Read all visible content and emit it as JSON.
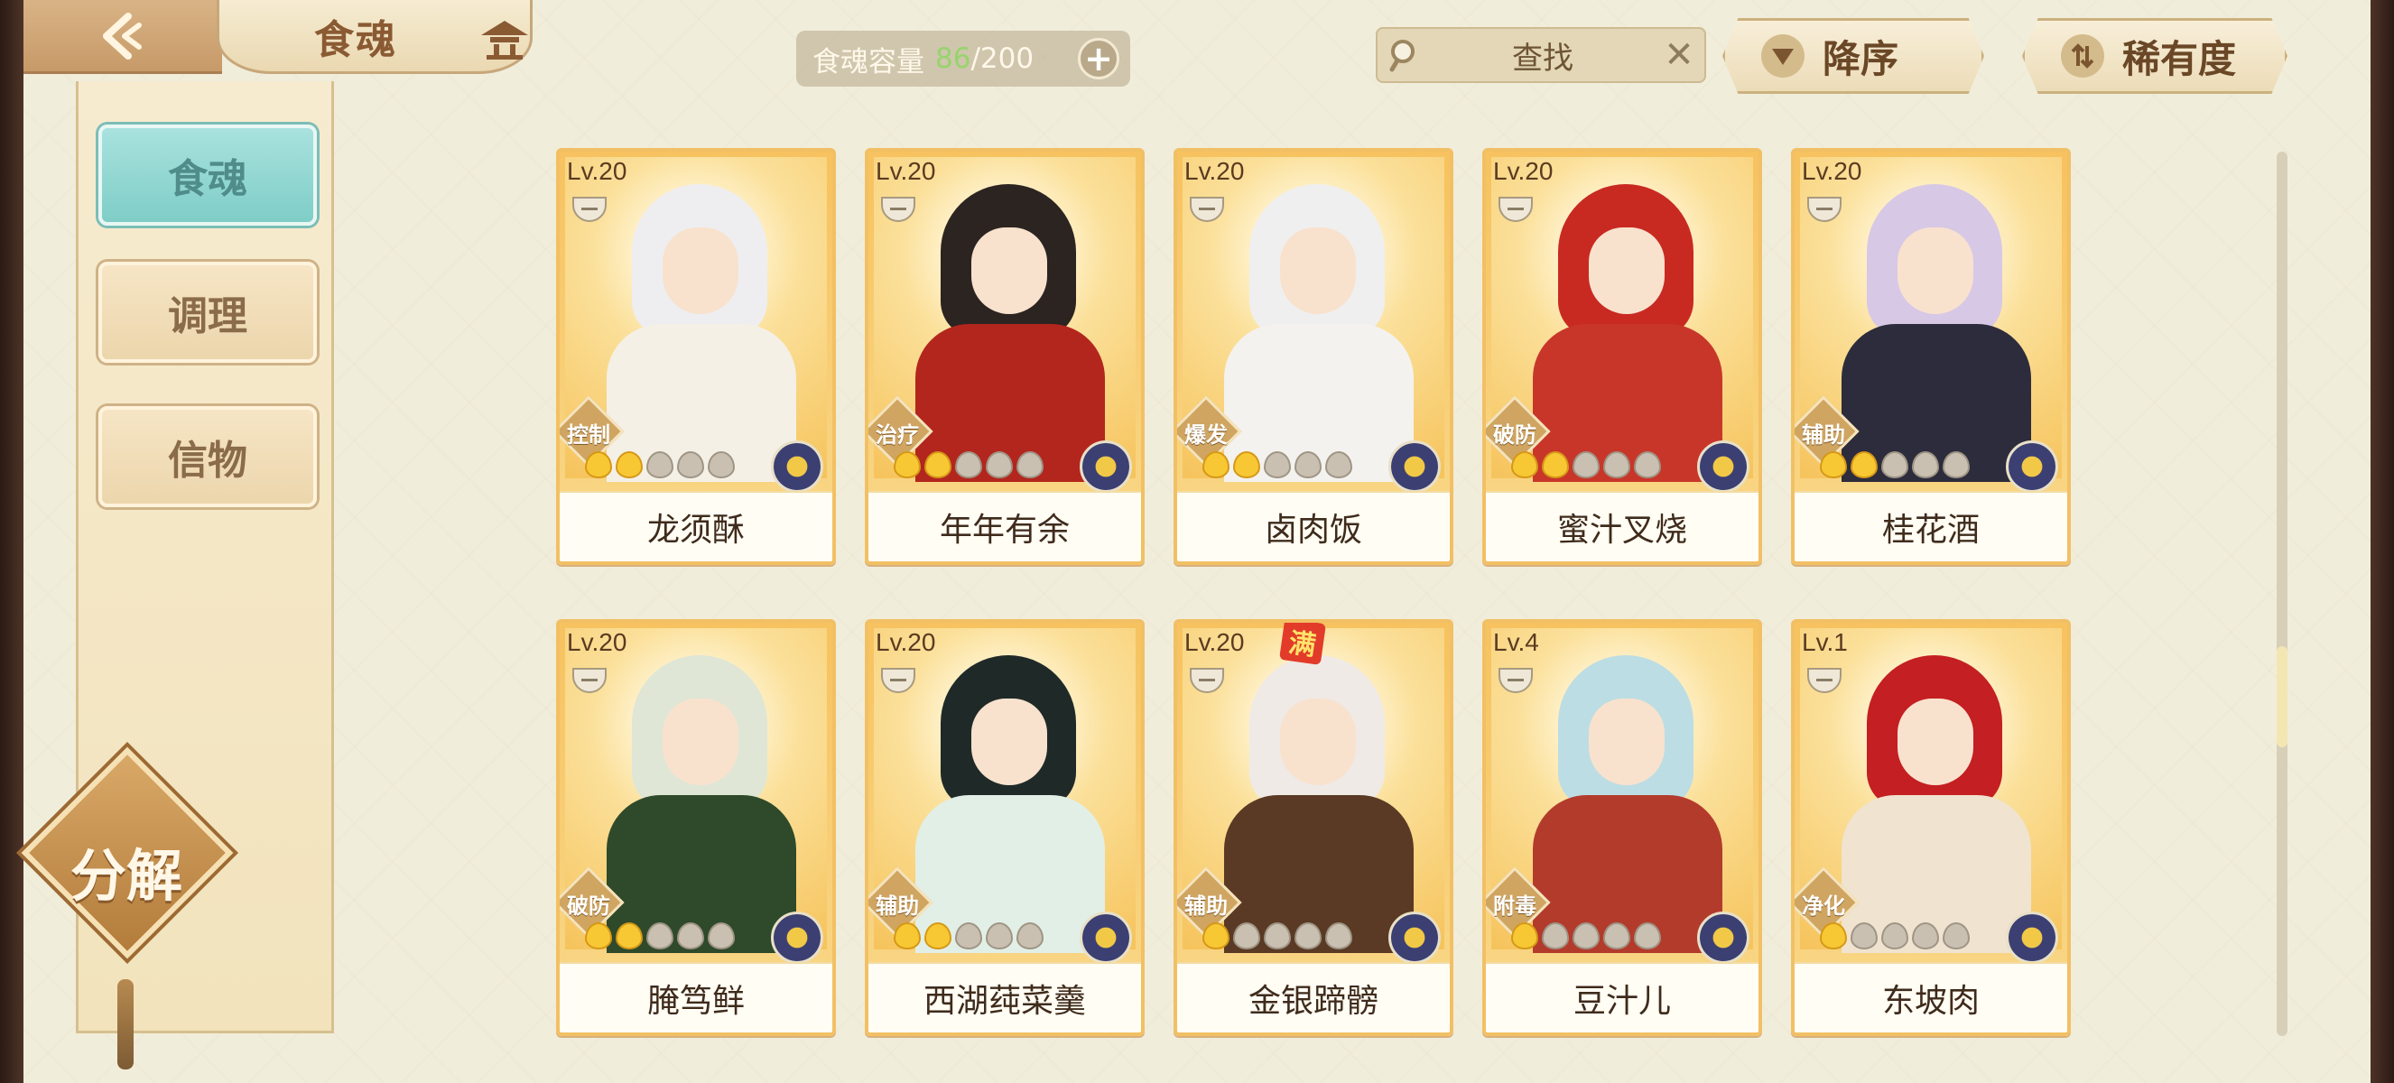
{
  "header": {
    "title": "食魂",
    "capacity_label": "食魂容量",
    "capacity_current": "86",
    "capacity_max": "200",
    "capacity_sep": "/",
    "plus_label": "+",
    "search_label": "查找",
    "close_label": "✕",
    "sort_order_label": "降序",
    "sort_field_label": "稀有度"
  },
  "sidebar": {
    "items": [
      {
        "label": "食魂",
        "active": true
      },
      {
        "label": "调理",
        "active": false
      },
      {
        "label": "信物",
        "active": false
      }
    ],
    "decompose_label": "分解"
  },
  "cards": [
    {
      "level": "Lv.20",
      "role": "控制",
      "name": "龙须酥",
      "stars": 2,
      "hair": "#eeeef1",
      "body": "#f4f0e6",
      "max": false
    },
    {
      "level": "Lv.20",
      "role": "治疗",
      "name": "年年有余",
      "stars": 2,
      "hair": "#2c2420",
      "body": "#b3261e",
      "max": false
    },
    {
      "level": "Lv.20",
      "role": "爆发",
      "name": "卤肉饭",
      "stars": 2,
      "hair": "#f0efef",
      "body": "#f4f2ee",
      "max": false
    },
    {
      "level": "Lv.20",
      "role": "破防",
      "name": "蜜汁叉烧",
      "stars": 2,
      "hair": "#c82a22",
      "body": "#c8362a",
      "max": false
    },
    {
      "level": "Lv.20",
      "role": "辅助",
      "name": "桂花酒",
      "stars": 2,
      "hair": "#d7c8e6",
      "body": "#2d2c3c",
      "max": false
    },
    {
      "level": "Lv.20",
      "role": "破防",
      "name": "腌笃鲜",
      "stars": 2,
      "hair": "#dfe6d6",
      "body": "#2e4a2a",
      "max": false
    },
    {
      "level": "Lv.20",
      "role": "辅助",
      "name": "西湖莼菜羹",
      "stars": 2,
      "hair": "#1f2a28",
      "body": "#e2efe6",
      "max": false
    },
    {
      "level": "Lv.20",
      "role": "辅助",
      "name": "金银蹄髈",
      "stars": 1,
      "hair": "#efeae6",
      "body": "#5a3a24",
      "max": true,
      "max_label": "满"
    },
    {
      "level": "Lv.4",
      "role": "附毒",
      "name": "豆汁儿",
      "stars": 1,
      "hair": "#bcdde3",
      "body": "#b33b2c",
      "max": false
    },
    {
      "level": "Lv.1",
      "role": "净化",
      "name": "东坡肉",
      "stars": 1,
      "hair": "#c41f22",
      "body": "#f0e3cf",
      "max": false
    }
  ]
}
